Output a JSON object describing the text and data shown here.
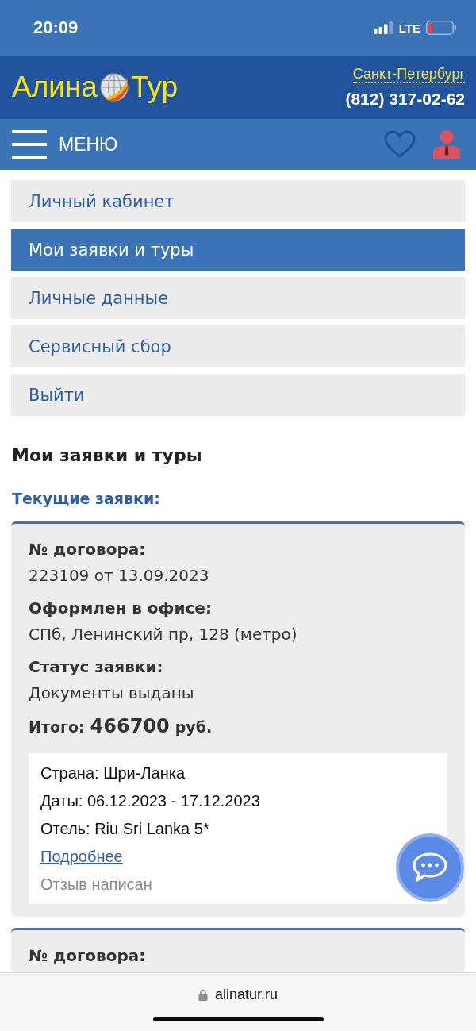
{
  "status_bar": {
    "time": "20:09",
    "network": "LTE"
  },
  "header": {
    "logo": {
      "part_1": "Алина",
      "part_2": "Тур"
    },
    "city": "Санкт-Петербург",
    "phone": "(812) 317-02-62"
  },
  "menu_bar": {
    "label": "МЕНЮ"
  },
  "account_nav": [
    {
      "label": "Личный кабинет",
      "selected": false
    },
    {
      "label": "Мои заявки и туры",
      "selected": true
    },
    {
      "label": "Личные данные",
      "selected": false
    },
    {
      "label": "Сервисный сбор",
      "selected": false
    },
    {
      "label": "Выйти",
      "selected": false
    }
  ],
  "page_title": "Мои заявки и туры",
  "section_title": "Текущие заявки:",
  "orders": [
    {
      "fields": [
        {
          "label": "№ договора:",
          "value": "223109 от 13.09.2023"
        },
        {
          "label": "Оформлен в офисе:",
          "value": "СПб, Ленинский пр, 128 (метро)"
        },
        {
          "label": "Статус заявки:",
          "value": "Документы выданы"
        }
      ],
      "total": {
        "label": "Итого:",
        "amount": "466700",
        "currency": "руб."
      },
      "tour": {
        "lines": [
          "Страна: Шри-Ланка",
          "Даты: 06.12.2023 - 17.12.2023",
          "Отель: Riu Sri Lanka 5*"
        ],
        "link": "Подробнее",
        "review_status": "Отзыв написан"
      }
    },
    {
      "fields": [
        {
          "label": "№ договора:"
        }
      ]
    }
  ],
  "browser_bar": {
    "url": "alinatur.ru"
  }
}
